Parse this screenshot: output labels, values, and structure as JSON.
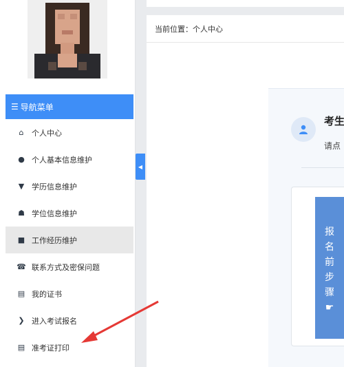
{
  "sidebar": {
    "nav_header": "导航菜单",
    "items": [
      {
        "label": "个人中心",
        "icon": "home-icon",
        "glyph": "⌂",
        "active": false
      },
      {
        "label": "个人基本信息维护",
        "icon": "user-icon",
        "glyph": "●",
        "active": false
      },
      {
        "label": "学历信息维护",
        "icon": "graduation-cap-icon",
        "glyph": "▼",
        "active": false
      },
      {
        "label": "学位信息维护",
        "icon": "medal-icon",
        "glyph": "☗",
        "active": false
      },
      {
        "label": "工作经历维护",
        "icon": "briefcase-icon",
        "glyph": "■",
        "active": true
      },
      {
        "label": "联系方式及密保问题",
        "icon": "phone-icon",
        "glyph": "☎",
        "active": false
      },
      {
        "label": "我的证书",
        "icon": "certificate-icon",
        "glyph": "▤",
        "active": false
      },
      {
        "label": "进入考试报名",
        "icon": "arrow-circle-icon",
        "glyph": "❯",
        "active": false
      },
      {
        "label": "准考证打印",
        "icon": "print-list-icon",
        "glyph": "▤",
        "active": false
      }
    ],
    "collapse_glyph": "◀"
  },
  "breadcrumb": "当前位置：个人中心",
  "main": {
    "title": "考生",
    "subtitle": "请点",
    "steps_text": [
      "报",
      "名",
      "前",
      "步",
      "骤"
    ],
    "steps_icon": "hand-pointer-icon"
  },
  "colors": {
    "accent": "#3e8ef7",
    "steps_blue": "#5a8fd8",
    "annotation_arrow": "#e53935"
  }
}
